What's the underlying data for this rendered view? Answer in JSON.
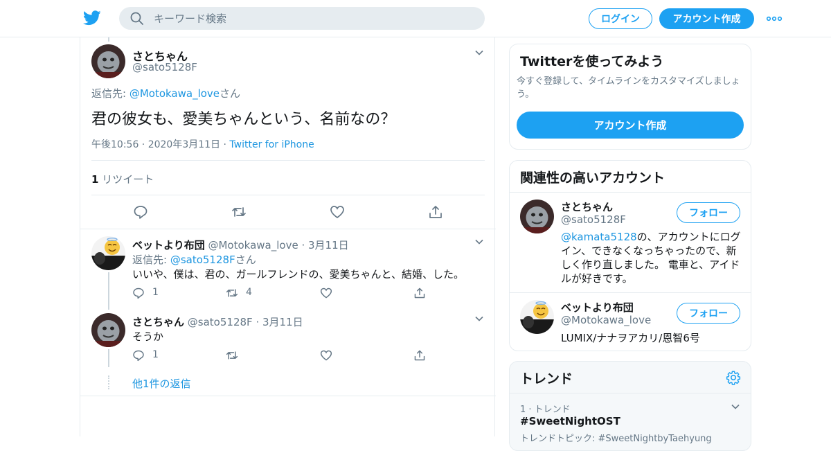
{
  "topbar": {
    "search_placeholder": "キーワード検索",
    "login_label": "ログイン",
    "signup_label": "アカウント作成"
  },
  "colors": {
    "accent": "#1da1f2",
    "link": "#1b95e0",
    "border": "#e6ecf0",
    "gray": "#657786"
  },
  "main_tweet": {
    "display_name": "さとちゃん",
    "handle": "@sato5128F",
    "reply_prefix": "返信先: ",
    "reply_to": "@Motokawa_love",
    "reply_suffix": "さん",
    "text": "君の彼女も、愛美ちゃんという、名前なの？",
    "timestamp": "午後10:56 · 2020年3月11日",
    "dot": " · ",
    "source": "Twitter for iPhone",
    "retweet_count": "1",
    "retweet_label": "リツイート"
  },
  "replies": [
    {
      "display_name": "ベットより布団",
      "handle": "@Motokawa_love",
      "date": "· 3月11日",
      "reply_prefix": "返信先: ",
      "reply_to": "@sato5128F",
      "reply_suffix": "さん",
      "text": "いいや、僕は、君の、ガールフレンドの、愛美ちゃんと、結婚、した。",
      "reply_count": "1",
      "retweet_count": "4"
    },
    {
      "display_name": "さとちゃん",
      "handle": "@sato5128F",
      "date": "· 3月11日",
      "text": "そうか",
      "reply_count": "1"
    }
  ],
  "more_replies_label": "他1件の返信",
  "signup_card": {
    "title": "Twitterを使ってみよう",
    "description": "今すぐ登録して、タイムラインをカスタマイズしましょう。",
    "button_label": "アカウント作成"
  },
  "related_card": {
    "title": "関連性の高いアカウント",
    "accounts": [
      {
        "display_name": "さとちゃん",
        "handle": "@sato5128F",
        "follow_label": "フォロー",
        "bio_link": "@kamata5128",
        "bio_line1": "の、アカウントにログ",
        "bio_line2": "イン、できなくなっちゃったので、新",
        "bio_line3": "しく作り直しました。 電車と、アイド",
        "bio_line4": "ルが好きです。"
      },
      {
        "display_name": "ベットより布団",
        "handle": "@Motokawa_love",
        "follow_label": "フォロー",
        "bio": "LUMIX/ナナヲアカリ/恩智6号"
      }
    ]
  },
  "trends_card": {
    "title": "トレンド",
    "items": [
      {
        "rank_label": "1 · トレンド",
        "name": "#SweetNightOST",
        "topic": "トレンドトピック: #SweetNightbyTaehyung"
      }
    ]
  }
}
